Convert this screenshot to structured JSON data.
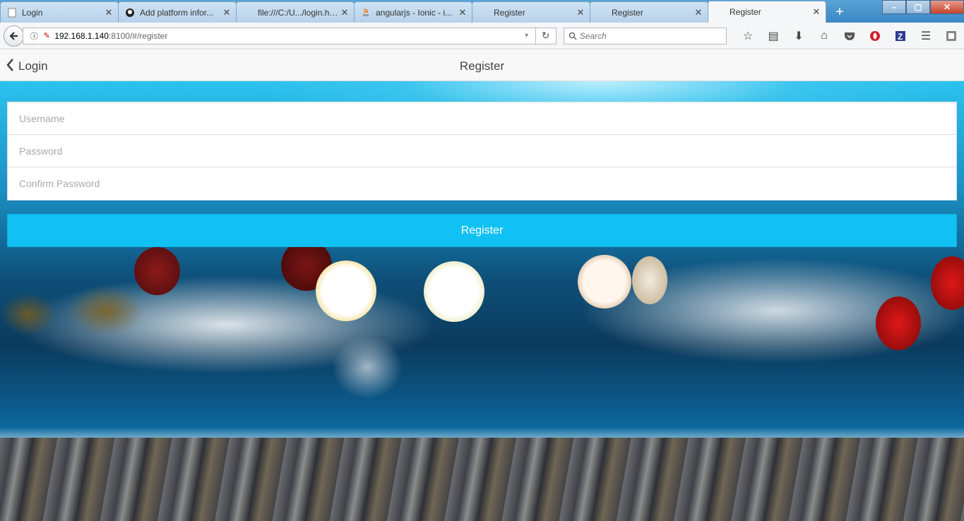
{
  "browser": {
    "tabs": [
      {
        "title": "Login",
        "icon": "page-icon",
        "active": false
      },
      {
        "title": "Add platform infor...",
        "icon": "github-icon",
        "active": false
      },
      {
        "title": "file:///C:/U.../login.html",
        "icon": "file-icon",
        "active": false
      },
      {
        "title": "angularjs - Ionic - i...",
        "icon": "stackoverflow-icon",
        "active": false
      },
      {
        "title": "Register",
        "icon": "page-icon",
        "active": false
      },
      {
        "title": "Register",
        "icon": "page-icon",
        "active": false
      },
      {
        "title": "Register",
        "icon": "page-icon",
        "active": true
      }
    ],
    "new_tab_label": "+",
    "url": {
      "host": "192.168.1.140",
      "path": ":8100/#/register"
    },
    "search_placeholder": "Search",
    "toolbar_icons": [
      "star-icon",
      "reading-list-icon",
      "download-icon",
      "home-icon",
      "pocket-icon",
      "opera-icon",
      "zotero-icon",
      "menu-icon",
      "extension-icon"
    ]
  },
  "app_header": {
    "back_label": "Login",
    "title": "Register"
  },
  "form": {
    "username_placeholder": "Username",
    "password_placeholder": "Password",
    "confirm_password_placeholder": "Confirm Password",
    "submit_label": "Register"
  },
  "colors": {
    "accent": "#11c1f3",
    "browser_chrome": "#3c86c4"
  }
}
